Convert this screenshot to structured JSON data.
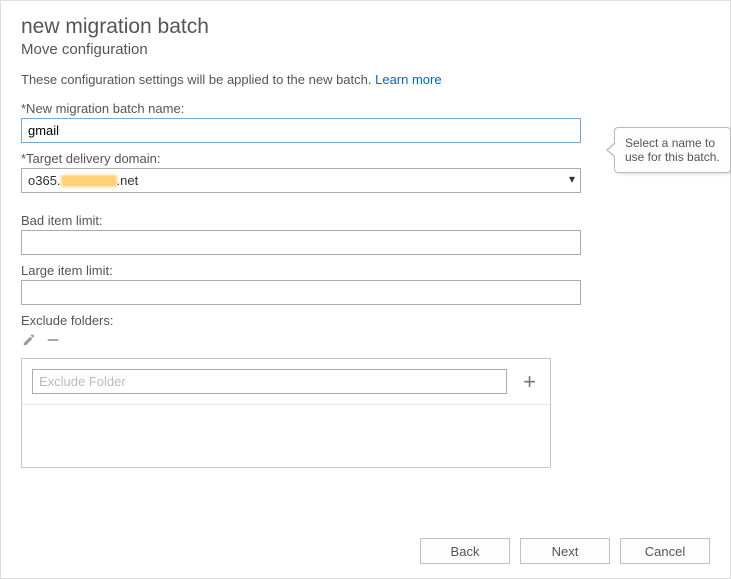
{
  "header": {
    "title": "new migration batch",
    "subtitle": "Move configuration"
  },
  "description": {
    "text": "These configuration settings will be applied to the new batch. ",
    "link_label": "Learn more"
  },
  "fields": {
    "batch_name": {
      "label": "*New migration batch name:",
      "value": "gmail"
    },
    "target_domain": {
      "label": "*Target delivery domain:",
      "prefix": "o365.",
      "suffix": ".net"
    },
    "bad_limit": {
      "label": "Bad item limit:",
      "value": ""
    },
    "large_limit": {
      "label": "Large item limit:",
      "value": ""
    },
    "exclude": {
      "label": "Exclude folders:",
      "placeholder": "Exclude Folder"
    }
  },
  "callout": {
    "text": "Select a name to use for this batch."
  },
  "footer": {
    "back": "Back",
    "next": "Next",
    "cancel": "Cancel"
  }
}
